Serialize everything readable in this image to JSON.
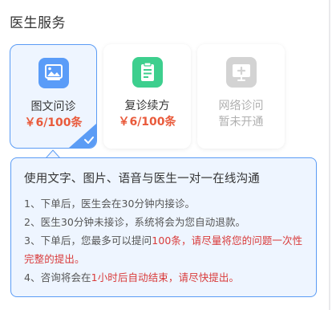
{
  "header": {
    "title": "医生服务"
  },
  "services": [
    {
      "label": "图文问诊",
      "price": "￥6/100条",
      "icon": "image-chat-icon",
      "color": "#5a9cf8",
      "selected": true
    },
    {
      "label": "复诊续方",
      "price": "￥6/100条",
      "icon": "prescription-icon",
      "color": "#3dcf8e",
      "selected": false
    },
    {
      "label": "网络诊问",
      "price": "暂未开通",
      "icon": "video-consult-icon",
      "color": "#d3d3d3",
      "selected": false
    }
  ],
  "info": {
    "title": "使用文字、图片、语音与医生一对一在线沟通",
    "rules": [
      {
        "segments": [
          {
            "text": "1、下单后，医生会在30分钟内接诊。",
            "red": false
          }
        ]
      },
      {
        "segments": [
          {
            "text": "2、医生30分钟未接诊，系统将会为您自动退款。",
            "red": false
          }
        ]
      },
      {
        "segments": [
          {
            "text": "3、下单后，您最多可以提问",
            "red": false
          },
          {
            "text": "100条，请尽量将您的问题一次性完整的提出。",
            "red": true
          }
        ]
      },
      {
        "segments": [
          {
            "text": "4、咨询将会在",
            "red": false
          },
          {
            "text": "1小时后自动结束，请尽快提出。",
            "red": true
          }
        ]
      }
    ]
  },
  "colors": {
    "accent": "#5b9cf5",
    "price": "#e95a3b",
    "warning": "#d93b3b"
  }
}
